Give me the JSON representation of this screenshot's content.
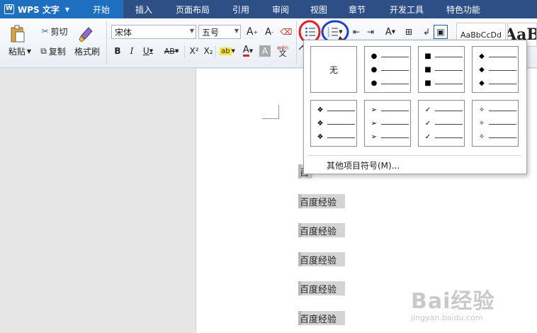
{
  "app": {
    "title": "WPS 文字",
    "icon": "wps-writer-icon"
  },
  "menu": {
    "tabs": [
      {
        "label": "开始",
        "active": true
      },
      {
        "label": "插入"
      },
      {
        "label": "页面布局"
      },
      {
        "label": "引用"
      },
      {
        "label": "审阅"
      },
      {
        "label": "视图"
      },
      {
        "label": "章节"
      },
      {
        "label": "开发工具"
      },
      {
        "label": "特色功能"
      }
    ]
  },
  "ribbon": {
    "paste": "粘贴",
    "cut": "剪切",
    "copy": "复制",
    "format_painter": "格式刷",
    "font_name": "宋体",
    "font_size": "五号",
    "grow_font": "A⁺",
    "shrink_font": "A⁻",
    "bold": "B",
    "italic": "I",
    "underline": "U",
    "strike": "AB",
    "superscript": "X²",
    "subscript": "X₂",
    "font_color": "A",
    "char_shade": "A",
    "phonetic": "wén\n文",
    "style_preview": "AaBbCcDd",
    "style_preview_big": "AaB"
  },
  "bullet_menu": {
    "none_label": "无",
    "styles": [
      {
        "symbol": "●",
        "icon": "round-bullet-icon"
      },
      {
        "symbol": "■",
        "icon": "square-bullet-icon"
      },
      {
        "symbol": "◆",
        "icon": "diamond-bullet-icon"
      },
      {
        "symbol": "❖",
        "icon": "four-diamond-bullet-icon"
      },
      {
        "symbol": "➢",
        "icon": "arrow-bullet-icon"
      },
      {
        "symbol": "✓",
        "icon": "check-bullet-icon"
      },
      {
        "symbol": "✧",
        "icon": "star-bullet-icon"
      }
    ],
    "more_label": "其他项目符号(M)..."
  },
  "document": {
    "lines": [
      "百",
      "百度经验",
      "百度经验",
      "百度经验",
      "百度经验",
      "百度经验"
    ]
  },
  "watermark": {
    "brand": "Bai经验",
    "url": "jingyan.baidu.com"
  },
  "colors": {
    "menubar": "#2d4f86",
    "accent": "#1f6fc0",
    "highlight_red": "#e0201c",
    "highlight_blue": "#1a3fd6"
  }
}
